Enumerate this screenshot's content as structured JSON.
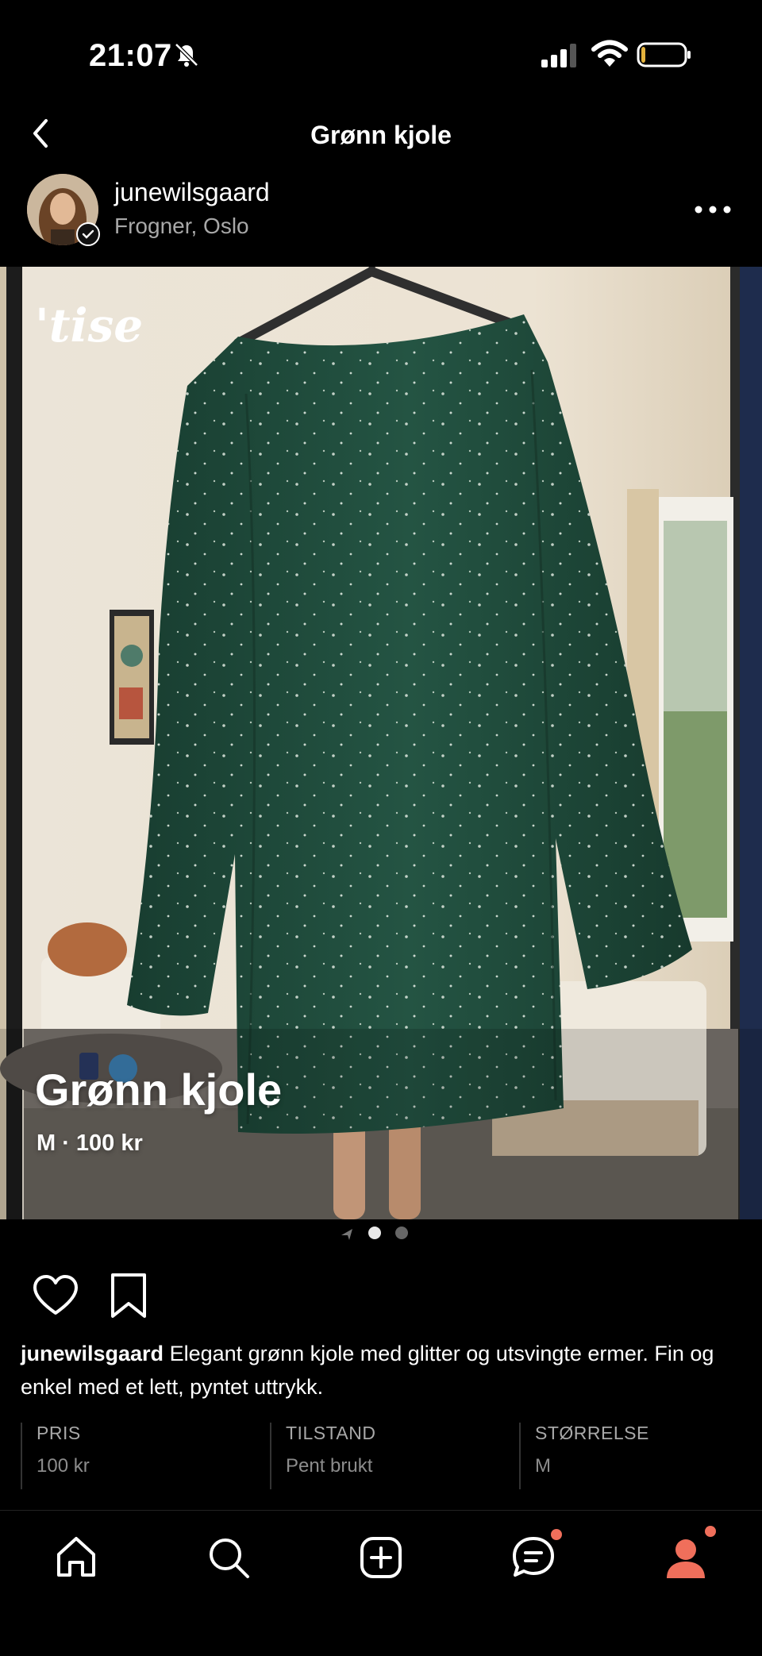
{
  "status_bar": {
    "time": "21:07"
  },
  "header": {
    "title": "Grønn kjole"
  },
  "seller": {
    "username": "junewilsgaard",
    "location": "Frogner, Oslo"
  },
  "photo": {
    "watermark": "'tise",
    "overlay_title": "Grønn kjole",
    "overlay_subtitle": "M · 100 kr",
    "image_count": 2,
    "active_index": 1
  },
  "description": {
    "username": "junewilsgaard",
    "text": "Elegant grønn kjole med glitter og utsvingte ermer. Fin og enkel med et lett, pyntet uttrykk."
  },
  "details": [
    {
      "label": "PRIS",
      "value": "100 kr"
    },
    {
      "label": "TILSTAND",
      "value": "Pent brukt"
    },
    {
      "label": "STØRRELSE",
      "value": "M"
    }
  ],
  "tab_bar": {
    "items": [
      {
        "name": "home-icon",
        "active": false,
        "badge": false
      },
      {
        "name": "search-icon",
        "active": false,
        "badge": false
      },
      {
        "name": "add-listing-icon",
        "active": false,
        "badge": false
      },
      {
        "name": "messages-icon",
        "active": false,
        "badge": true
      },
      {
        "name": "profile-icon",
        "active": true,
        "badge": true
      }
    ]
  },
  "colors": {
    "background": "#000000",
    "accent": "#f06f5b",
    "dress": "#1f4a3a"
  }
}
